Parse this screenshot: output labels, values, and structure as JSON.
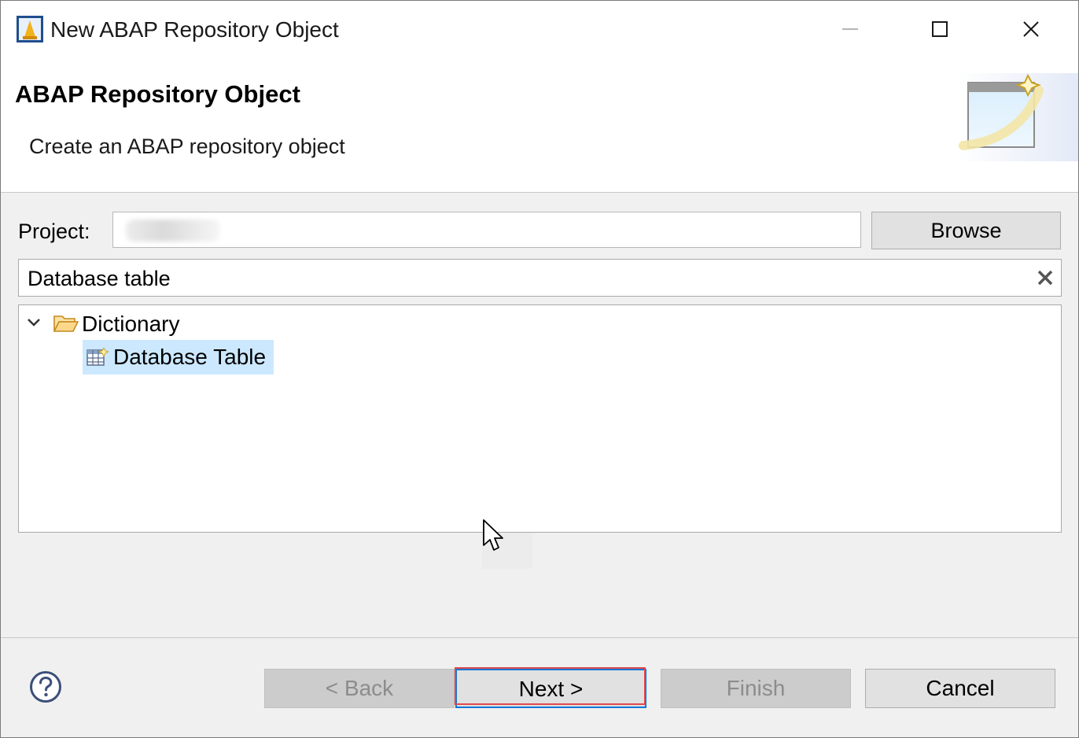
{
  "window": {
    "title": "New ABAP Repository Object",
    "controls": [
      "minimize-icon",
      "maximize-icon",
      "close-icon"
    ]
  },
  "banner": {
    "title": "ABAP Repository Object",
    "description": "Create an ABAP repository object",
    "graphic": "new-wizard-graphic"
  },
  "form": {
    "project_label": "Project:",
    "project_value": "",
    "browse_label": "Browse",
    "filter_value": "Database table",
    "clear_icon": "clear-x-icon"
  },
  "tree": {
    "nodes": [
      {
        "label": "Dictionary",
        "icon": "open-folder-icon",
        "expanded": true,
        "children": [
          {
            "label": "Database Table",
            "icon": "database-table-icon",
            "selected": true
          }
        ]
      }
    ]
  },
  "footer": {
    "help_icon": "help-icon",
    "back_label": "< Back",
    "next_label": "Next >",
    "finish_label": "Finish",
    "cancel_label": "Cancel"
  },
  "colors": {
    "selection": "#cce8ff",
    "focus_border": "#0078d7",
    "highlight_annotation": "#e0474c",
    "disabled_text": "#8c8c8c",
    "dialog_background": "#f0f0f0"
  }
}
